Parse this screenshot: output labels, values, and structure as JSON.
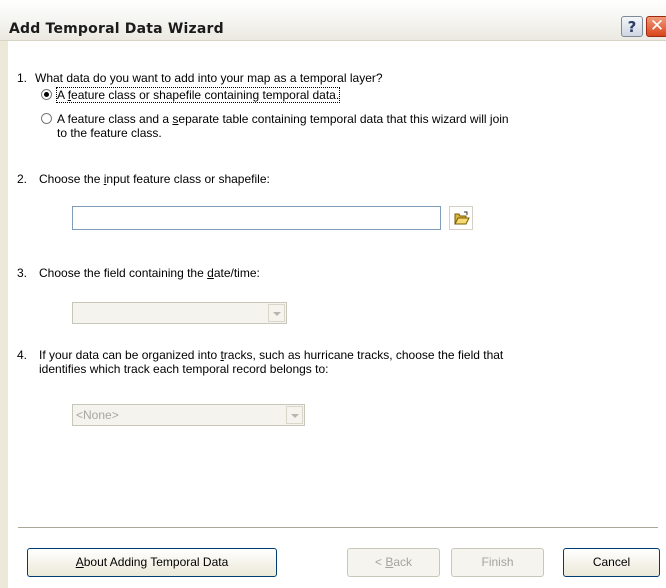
{
  "window": {
    "title": "Add Temporal Data Wizard",
    "help_label": "?",
    "close_label": "✕"
  },
  "q1": {
    "number": "1.",
    "text": "What data do you want to add into your map as a temporal layer?",
    "option1": {
      "pre": "A ",
      "key": "f",
      "post": "eature class or shapefile containing temporal data.",
      "selected": true
    },
    "option2": {
      "line1_pre": "A feature class and a ",
      "key": "s",
      "line1_post": "eparate table containing temporal data that this wizard will join",
      "line2": "to the feature class.",
      "selected": false
    }
  },
  "q2": {
    "number": "2.",
    "pre": "Choose the ",
    "key": "i",
    "post": "nput feature class or shapefile:",
    "input_value": ""
  },
  "q3": {
    "number": "3.",
    "pre": "Choose the field containing the ",
    "key": "d",
    "post": "ate/time:",
    "selected_value": ""
  },
  "q4": {
    "number": "4.",
    "line1_pre": "If your data can be organized into ",
    "key": "t",
    "line1_post": "racks, such as hurricane tracks, choose the field that",
    "line2": "identifies which track each temporal record belongs to:",
    "selected_value": "<None>"
  },
  "buttons": {
    "about": {
      "key": "A",
      "rest": "bout Adding Temporal Data"
    },
    "back": {
      "pre": "< ",
      "key": "B",
      "rest": "ack"
    },
    "finish": "Finish",
    "cancel": "Cancel"
  },
  "icons": {
    "browse": "open-folder-icon",
    "dropdown": "chevron-down-icon"
  }
}
